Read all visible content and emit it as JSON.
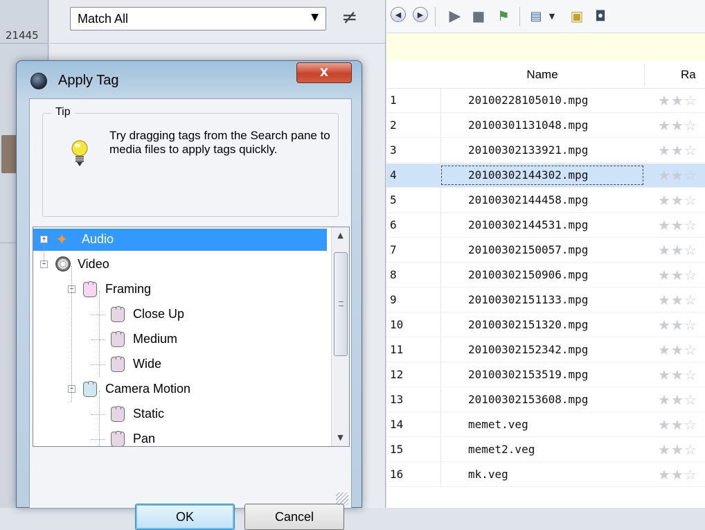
{
  "background": {
    "left_number": "21445",
    "match_select": {
      "value": "Match All",
      "arrow_icon": "chevron-down-icon"
    },
    "not_equal_symbol": "≠"
  },
  "toolbar": {
    "icons": [
      "back-circle-icon",
      "forward-circle-icon",
      "play-icon",
      "stop-icon",
      "cursor-flag-icon",
      "view-columns-icon",
      "dropdown-arrow-icon",
      "folder-icon",
      "save-icon"
    ]
  },
  "file_list": {
    "columns": [
      "Name",
      "Ra"
    ],
    "selected_index": 3,
    "rows": [
      {
        "n": "1",
        "name": "20100228105010.mpg"
      },
      {
        "n": "2",
        "name": "20100301131048.mpg"
      },
      {
        "n": "3",
        "name": "20100302133921.mpg"
      },
      {
        "n": "4",
        "name": "20100302144302.mpg"
      },
      {
        "n": "5",
        "name": "20100302144458.mpg"
      },
      {
        "n": "6",
        "name": "20100302144531.mpg"
      },
      {
        "n": "7",
        "name": "20100302150057.mpg"
      },
      {
        "n": "8",
        "name": "20100302150906.mpg"
      },
      {
        "n": "9",
        "name": "20100302151133.mpg"
      },
      {
        "n": "10",
        "name": "20100302151320.mpg"
      },
      {
        "n": "11",
        "name": "20100302152342.mpg"
      },
      {
        "n": "12",
        "name": "20100302153519.mpg"
      },
      {
        "n": "13",
        "name": "20100302153608.mpg"
      },
      {
        "n": "14",
        "name": "memet.veg"
      },
      {
        "n": "15",
        "name": "memet2.veg"
      },
      {
        "n": "16",
        "name": "mk.veg"
      }
    ],
    "rating_glyphs": "★★☆"
  },
  "dialog": {
    "title": "Apply Tag",
    "close_label": "X",
    "tip": {
      "caption": "Tip",
      "text": "Try dragging tags from the Search pane to media files to apply tags quickly."
    },
    "tree": [
      {
        "label": "Audio",
        "level": 0,
        "expander": "+",
        "icon": "audio-star-icon",
        "selected": true
      },
      {
        "label": "Video",
        "level": 0,
        "expander": "−",
        "icon": "video-reel-icon"
      },
      {
        "label": "Framing",
        "level": 1,
        "expander": "−",
        "icon": "tag-icon",
        "color": "pink"
      },
      {
        "label": "Close Up",
        "level": 2,
        "icon": "tag-icon",
        "color": "mauve"
      },
      {
        "label": "Medium",
        "level": 2,
        "icon": "tag-icon",
        "color": "mauve"
      },
      {
        "label": "Wide",
        "level": 2,
        "icon": "tag-icon",
        "color": "mauve"
      },
      {
        "label": "Camera Motion",
        "level": 1,
        "expander": "−",
        "icon": "tag-icon",
        "color": "blue"
      },
      {
        "label": "Static",
        "level": 2,
        "icon": "tag-icon",
        "color": "mauve"
      },
      {
        "label": "Pan",
        "level": 2,
        "icon": "tag-icon",
        "color": "mauve"
      }
    ],
    "ok_label": "OK",
    "cancel_label": "Cancel"
  }
}
